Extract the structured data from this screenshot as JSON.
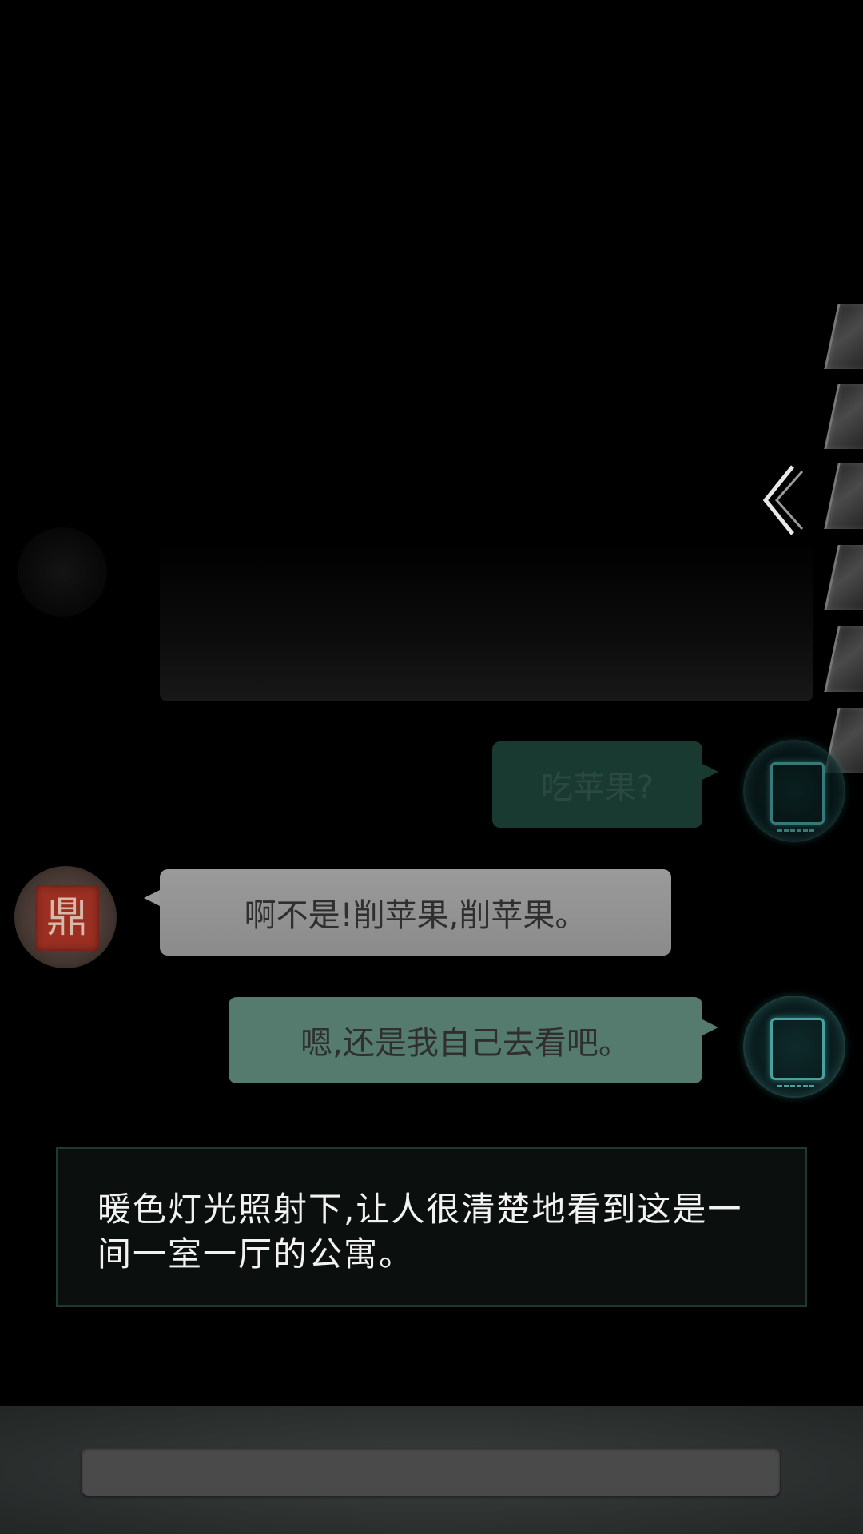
{
  "conversation": {
    "messages": [
      {
        "speaker": "player",
        "text": "吃苹果?"
      },
      {
        "speaker": "npc",
        "text": "啊不是!削苹果,削苹果。"
      },
      {
        "speaker": "player",
        "text": "嗯,还是我自己去看吧。"
      }
    ],
    "narration": "暖色灯光照射下,让人很清楚地看到这是一间一室一厅的公寓。"
  },
  "npc_avatar": {
    "icon": "red-seal-icon"
  },
  "player_avatar": {
    "icon": "glowing-paper-icon"
  },
  "side_panel": {
    "icon": "chevron-left-icon",
    "card_count": 6
  },
  "colors": {
    "player_bubble": "#557a6e",
    "npc_bubble": "#999999",
    "narration_bg": "#0b0f0d",
    "background": "#000000"
  }
}
